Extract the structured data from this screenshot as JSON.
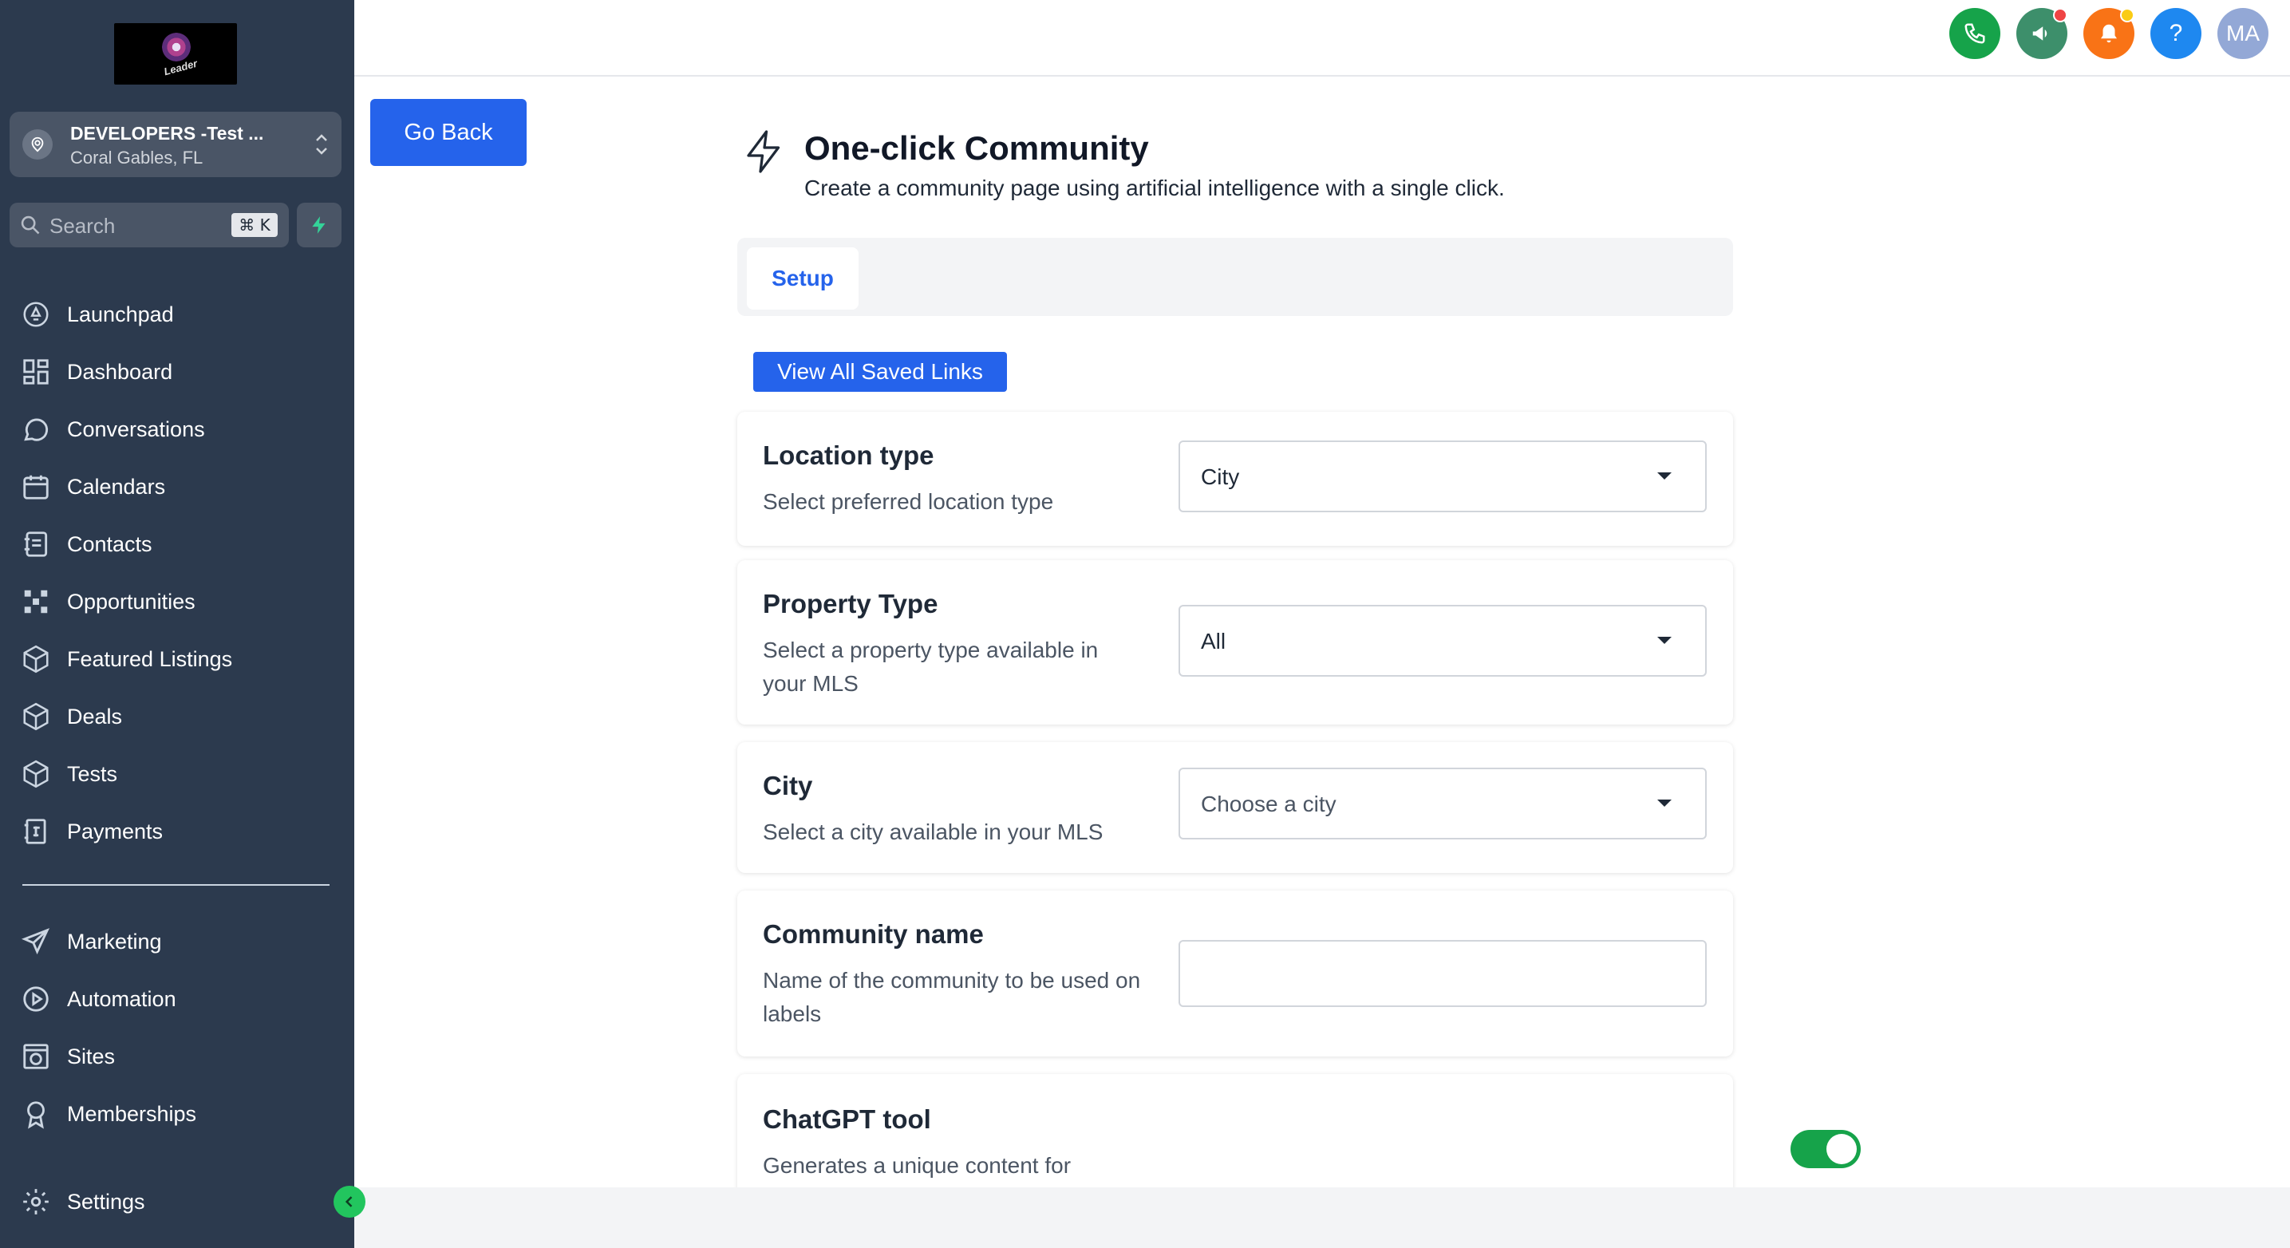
{
  "account": {
    "name": "DEVELOPERS -Test ...",
    "location": "Coral Gables, FL"
  },
  "search": {
    "label": "Search",
    "shortcut": "⌘ K"
  },
  "nav": {
    "launchpad": "Launchpad",
    "dashboard": "Dashboard",
    "conversations": "Conversations",
    "calendars": "Calendars",
    "contacts": "Contacts",
    "opportunities": "Opportunities",
    "featured_listings": "Featured Listings",
    "deals": "Deals",
    "tests": "Tests",
    "payments": "Payments",
    "marketing": "Marketing",
    "automation": "Automation",
    "sites": "Sites",
    "memberships": "Memberships",
    "settings": "Settings"
  },
  "topbar": {
    "help": "?",
    "avatar": "MA"
  },
  "colors": {
    "sidebar": "#2c3a4e",
    "primary": "#2563eb",
    "phone": "#16a34a",
    "announce": "#3d8f6b",
    "bell": "#f97316",
    "help": "#1e88f0",
    "avatar": "#93a8d6"
  },
  "logo": {
    "text": "Leader"
  },
  "page": {
    "go_back": "Go Back",
    "title": "One-click Community",
    "subtitle": "Create a community page using artificial intelligence with a single click.",
    "tab_setup": "Setup",
    "saved_links": "View All Saved Links"
  },
  "form": {
    "location_type": {
      "title": "Location type",
      "desc": "Select preferred location type",
      "value": "City"
    },
    "property_type": {
      "title": "Property Type",
      "desc": "Select a property type available in your MLS",
      "value": "All"
    },
    "city": {
      "title": "City",
      "desc": "Select a city available in your MLS",
      "placeholder": "Choose a city"
    },
    "community_name": {
      "title": "Community name",
      "desc": "Name of the community to be used on labels",
      "value": ""
    },
    "chatgpt": {
      "title": "ChatGPT tool",
      "desc": "Generates a unique content for",
      "enabled": true
    }
  }
}
